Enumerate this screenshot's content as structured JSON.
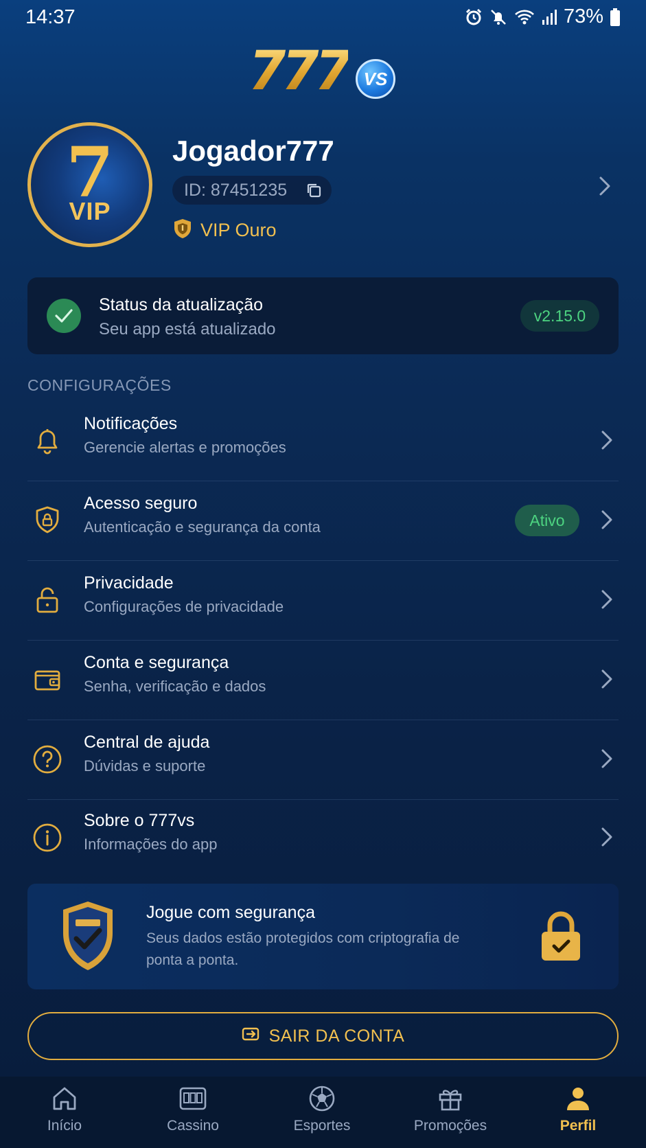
{
  "status_bar": {
    "time": "14:37",
    "battery": "73%"
  },
  "logo": {
    "text": "777",
    "badge": "VS"
  },
  "profile": {
    "avatar_number": "7",
    "avatar_badge": "VIP",
    "username": "Jogador777",
    "id": "ID: 87451235",
    "vip_level": "VIP Ouro"
  },
  "update": {
    "title": "Status da atualização",
    "subtitle": "Seu app está atualizado",
    "version": "v2.15.0"
  },
  "section_label": "CONFIGURAÇÕES",
  "menu": [
    {
      "title": "Notificações",
      "subtitle": "Gerencie alertas e promoções",
      "icon": "bell-icon"
    },
    {
      "title": "Acesso seguro",
      "subtitle": "Autenticação e segurança da conta",
      "icon": "shield-lock-icon",
      "badge": "Ativo"
    },
    {
      "title": "Privacidade",
      "subtitle": "Configurações de privacidade",
      "icon": "lock-icon"
    },
    {
      "title": "Conta e segurança",
      "subtitle": "Senha, verificação e dados",
      "icon": "wallet-icon"
    },
    {
      "title": "Central de ajuda",
      "subtitle": "Dúvidas e suporte",
      "icon": "help-icon"
    },
    {
      "title": "Sobre o 777vs",
      "subtitle": "Informações do app",
      "icon": "info-icon"
    }
  ],
  "safe_card": {
    "title": "Jogue com segurança",
    "text": "Seus dados estão protegidos com criptografia de ponta a ponta."
  },
  "logout_label": "SAIR DA CONTA",
  "nav": [
    {
      "label": "Início",
      "icon": "home-icon"
    },
    {
      "label": "Cassino",
      "icon": "slot-machine-icon"
    },
    {
      "label": "Esportes",
      "icon": "soccer-ball-icon"
    },
    {
      "label": "Promoções",
      "icon": "gift-icon"
    },
    {
      "label": "Perfil",
      "icon": "user-icon",
      "active": true
    }
  ],
  "colors": {
    "accent_gold": "#f1c050",
    "success_green": "#4dd481",
    "background": "#0a2a55"
  }
}
